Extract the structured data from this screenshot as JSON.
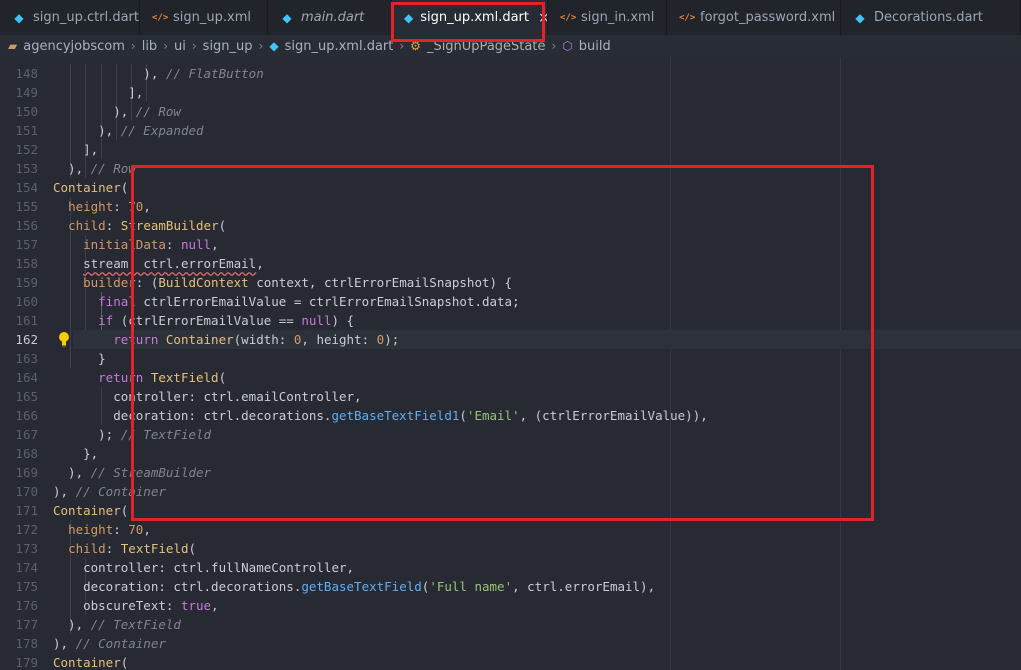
{
  "tabs": [
    {
      "label": "sign_up.ctrl.dart",
      "icon": "dart",
      "active": false
    },
    {
      "label": "sign_up.xml",
      "icon": "xml",
      "active": false
    },
    {
      "label": "main.dart",
      "icon": "dart",
      "active": false,
      "italic": true
    },
    {
      "label": "sign_up.xml.dart",
      "icon": "dart",
      "active": true
    },
    {
      "label": "sign_in.xml",
      "icon": "xml",
      "active": false
    },
    {
      "label": "forgot_password.xml",
      "icon": "xml",
      "active": false
    },
    {
      "label": "Decorations.dart",
      "icon": "dart",
      "active": false
    }
  ],
  "tab_close_symbol": "×",
  "breadcrumb": [
    {
      "label": "agencyjobscom",
      "icon": "folder"
    },
    {
      "label": "lib",
      "icon": ""
    },
    {
      "label": "ui",
      "icon": ""
    },
    {
      "label": "sign_up",
      "icon": ""
    },
    {
      "label": "sign_up.xml.dart",
      "icon": "dart"
    },
    {
      "label": "_SignUpPageState",
      "icon": "class"
    },
    {
      "label": "build",
      "icon": "method"
    }
  ],
  "current_line": 162,
  "lines": [
    {
      "n": 148,
      "parts": [
        [
          "p",
          "            ), "
        ],
        [
          "c",
          "// FlatButton"
        ]
      ]
    },
    {
      "n": 149,
      "parts": [
        [
          "p",
          "          ],"
        ]
      ]
    },
    {
      "n": 150,
      "parts": [
        [
          "p",
          "        ), "
        ],
        [
          "c",
          "// Row"
        ]
      ]
    },
    {
      "n": 151,
      "parts": [
        [
          "p",
          "      ), "
        ],
        [
          "c",
          "// Expanded"
        ]
      ]
    },
    {
      "n": 152,
      "parts": [
        [
          "p",
          "    ],"
        ]
      ]
    },
    {
      "n": 153,
      "parts": [
        [
          "p",
          "  ), "
        ],
        [
          "c",
          "// Row"
        ]
      ]
    },
    {
      "n": 154,
      "parts": [
        [
          "t",
          "Container"
        ],
        [
          "p",
          "("
        ]
      ]
    },
    {
      "n": 155,
      "parts": [
        [
          "p",
          "  "
        ],
        [
          "n",
          "height"
        ],
        [
          "p",
          ": "
        ],
        [
          "n",
          "70"
        ],
        [
          "p",
          ","
        ]
      ]
    },
    {
      "n": 156,
      "parts": [
        [
          "p",
          "  "
        ],
        [
          "n",
          "child"
        ],
        [
          "p",
          ": "
        ],
        [
          "t",
          "StreamBuilder"
        ],
        [
          "p",
          "("
        ]
      ]
    },
    {
      "n": 157,
      "parts": [
        [
          "p",
          "    "
        ],
        [
          "n",
          "initialData"
        ],
        [
          "p",
          ": "
        ],
        [
          "k",
          "null"
        ],
        [
          "p",
          ","
        ]
      ]
    },
    {
      "n": 158,
      "parts": [
        [
          "p",
          "    "
        ],
        [
          "sq",
          "stream: ctrl.errorEmail"
        ],
        [
          "p",
          ","
        ]
      ]
    },
    {
      "n": 159,
      "parts": [
        [
          "p",
          "    "
        ],
        [
          "n",
          "builder"
        ],
        [
          "p",
          ": ("
        ],
        [
          "t",
          "BuildContext"
        ],
        [
          "p",
          " context, ctrlErrorEmailSnapshot) {"
        ]
      ]
    },
    {
      "n": 160,
      "parts": [
        [
          "p",
          "      "
        ],
        [
          "k",
          "final"
        ],
        [
          "p",
          " ctrlErrorEmailValue = ctrlErrorEmailSnapshot.data;"
        ]
      ]
    },
    {
      "n": 161,
      "parts": [
        [
          "p",
          "      "
        ],
        [
          "k",
          "if"
        ],
        [
          "p",
          " (ctrlErrorEmailValue == "
        ],
        [
          "k",
          "null"
        ],
        [
          "p",
          ") {"
        ]
      ]
    },
    {
      "n": 162,
      "parts": [
        [
          "p",
          "        "
        ],
        [
          "k",
          "return"
        ],
        [
          "p",
          " "
        ],
        [
          "t",
          "Container"
        ],
        [
          "p",
          "(width: "
        ],
        [
          "n",
          "0"
        ],
        [
          "p",
          ", height: "
        ],
        [
          "n",
          "0"
        ],
        [
          "p",
          ");"
        ]
      ]
    },
    {
      "n": 163,
      "parts": [
        [
          "p",
          "      }"
        ]
      ]
    },
    {
      "n": 164,
      "parts": [
        [
          "p",
          "      "
        ],
        [
          "k",
          "return"
        ],
        [
          "p",
          " "
        ],
        [
          "t",
          "TextField"
        ],
        [
          "p",
          "("
        ]
      ]
    },
    {
      "n": 165,
      "parts": [
        [
          "p",
          "        controller: ctrl.emailController,"
        ]
      ]
    },
    {
      "n": 166,
      "parts": [
        [
          "p",
          "        decoration: ctrl.decorations."
        ],
        [
          "f",
          "getBaseTextField1"
        ],
        [
          "p",
          "("
        ],
        [
          "s",
          "'Email'"
        ],
        [
          "p",
          ", (ctrlErrorEmailValue)),"
        ]
      ]
    },
    {
      "n": 167,
      "parts": [
        [
          "p",
          "      ); "
        ],
        [
          "c",
          "// TextField"
        ]
      ]
    },
    {
      "n": 168,
      "parts": [
        [
          "p",
          "    },"
        ]
      ]
    },
    {
      "n": 169,
      "parts": [
        [
          "p",
          "  ), "
        ],
        [
          "c",
          "// StreamBuilder"
        ]
      ]
    },
    {
      "n": 170,
      "parts": [
        [
          "p",
          "), "
        ],
        [
          "c",
          "// Container"
        ]
      ]
    },
    {
      "n": 171,
      "parts": [
        [
          "t",
          "Container"
        ],
        [
          "p",
          "("
        ]
      ]
    },
    {
      "n": 172,
      "parts": [
        [
          "p",
          "  "
        ],
        [
          "n",
          "height"
        ],
        [
          "p",
          ": "
        ],
        [
          "n",
          "70"
        ],
        [
          "p",
          ","
        ]
      ]
    },
    {
      "n": 173,
      "parts": [
        [
          "p",
          "  "
        ],
        [
          "n",
          "child"
        ],
        [
          "p",
          ": "
        ],
        [
          "t",
          "TextField"
        ],
        [
          "p",
          "("
        ]
      ]
    },
    {
      "n": 174,
      "parts": [
        [
          "p",
          "    controller: ctrl.fullNameController,"
        ]
      ]
    },
    {
      "n": 175,
      "parts": [
        [
          "p",
          "    decoration: ctrl.decorations."
        ],
        [
          "f",
          "getBaseTextField"
        ],
        [
          "p",
          "("
        ],
        [
          "s",
          "'Full name'"
        ],
        [
          "p",
          ", ctrl.errorEmail),"
        ]
      ]
    },
    {
      "n": 176,
      "parts": [
        [
          "p",
          "    obscureText: "
        ],
        [
          "k",
          "true"
        ],
        [
          "p",
          ","
        ]
      ]
    },
    {
      "n": 177,
      "parts": [
        [
          "p",
          "  ), "
        ],
        [
          "c",
          "// TextField"
        ]
      ]
    },
    {
      "n": 178,
      "parts": [
        [
          "p",
          "), "
        ],
        [
          "c",
          "// Container"
        ]
      ]
    },
    {
      "n": 179,
      "parts": [
        [
          "t",
          "Container"
        ],
        [
          "p",
          "("
        ]
      ]
    }
  ],
  "colors": {
    "highlight_box": "#e3222a",
    "keyword": "#c678dd",
    "type": "#e5c07b",
    "function": "#61afef",
    "string": "#98c379",
    "comment": "#7f848e"
  }
}
